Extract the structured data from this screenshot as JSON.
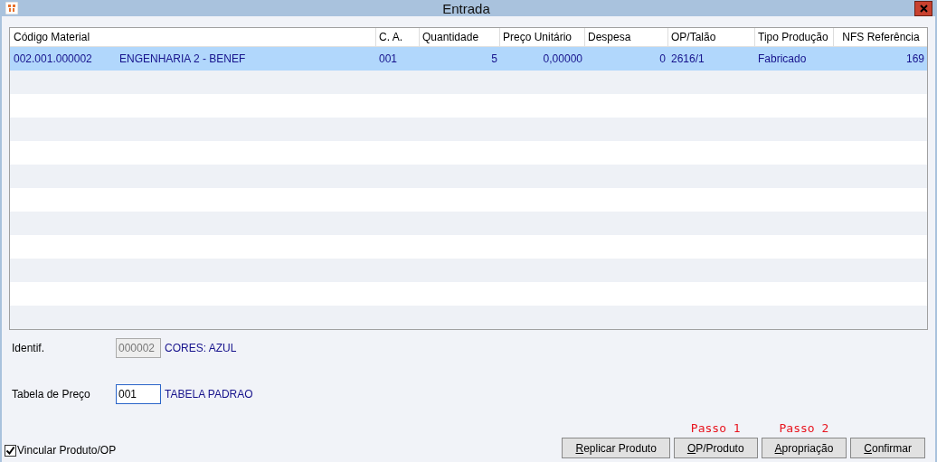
{
  "window": {
    "title": "Entrada"
  },
  "table": {
    "columns": [
      "Código Material",
      "C. A.",
      "Quantidade",
      "Preço Unitário",
      "Despesa",
      "OP/Talão",
      "Tipo Produção",
      "NFS Referência"
    ],
    "rows": [
      {
        "selected": true,
        "cells": [
          {
            "code": "002.001.000002",
            "name": "ENGENHARIA 2 - BENEF"
          },
          "001",
          "5",
          "0,00000",
          "0",
          "2616/1",
          "Fabricado",
          "169"
        ]
      }
    ]
  },
  "identif": {
    "label": "Identif.",
    "value": "000002",
    "disabled": true,
    "description": "CORES: AZUL"
  },
  "tabela_preco": {
    "label": "Tabela de Preço",
    "value": "001",
    "description": "TABELA PADRAO"
  },
  "vincular": {
    "label": "Vincular Produto/OP",
    "checked": true
  },
  "buttons": [
    {
      "label": "Replicar Produto"
    },
    {
      "label": "OP/Produto",
      "step": "Passo 1"
    },
    {
      "label": "Apropriação",
      "step": "Passo 2"
    },
    {
      "label": "Confirmar"
    }
  ]
}
